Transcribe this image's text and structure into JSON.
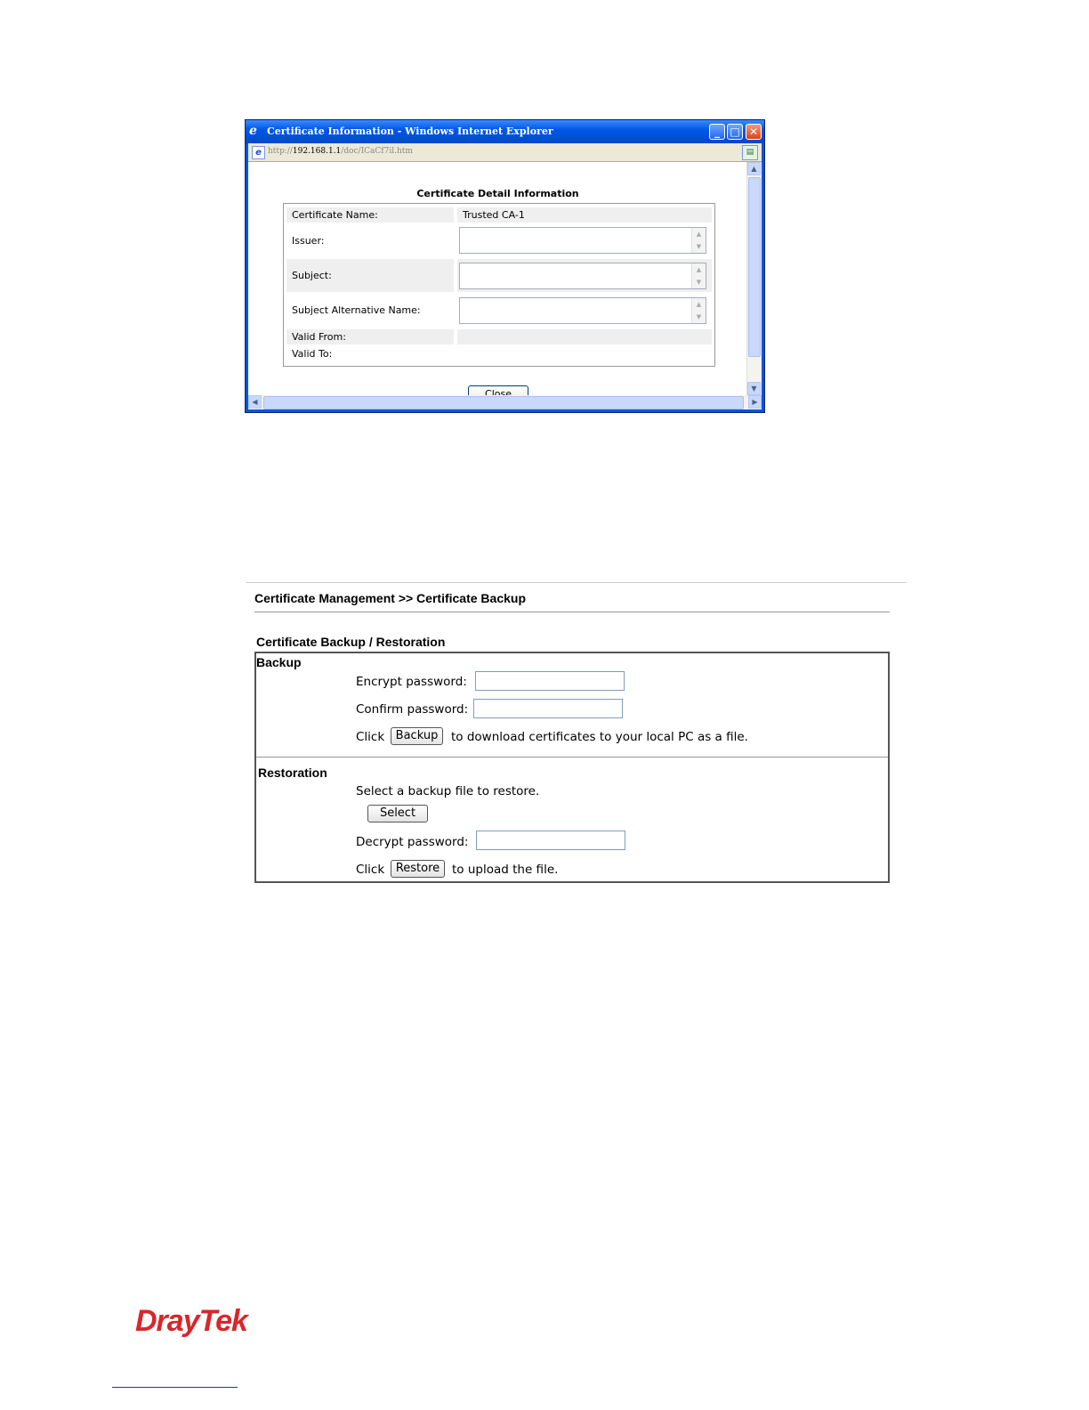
{
  "popup": {
    "window_title": "Certificate Information - Windows Internet Explorer",
    "address": {
      "prefix": "http://",
      "host": "192.168.1.1",
      "path": "/doc/ICaCf7il.htm"
    },
    "heading": "Certificate Detail Information",
    "rows": {
      "cert_name_label": "Certificate Name:",
      "cert_name_value": "Trusted CA-1",
      "issuer_label": "Issuer:",
      "subject_label": "Subject:",
      "subject_alt_label": "Subject Alternative Name:",
      "valid_from_label": "Valid From:",
      "valid_to_label": "Valid To:"
    },
    "close_label": "Close"
  },
  "backup_page": {
    "breadcrumb": "Certificate Management >> Certificate Backup",
    "section_title": "Certificate Backup / Restoration",
    "backup": {
      "label": "Backup",
      "encrypt_label": "Encrypt password:",
      "confirm_label": "Confirm password:",
      "click_label": "Click",
      "button": "Backup",
      "after_text": "to download certificates to your local PC as a file."
    },
    "restoration": {
      "label": "Restoration",
      "select_text": "Select a backup file to restore.",
      "select_button": "Select",
      "decrypt_label": "Decrypt password:",
      "click_label": "Click",
      "button": "Restore",
      "after_text": "to upload the file."
    }
  },
  "footer": {
    "logo": "DrayTek"
  },
  "colors": {
    "logo_red": "#d8262b",
    "titlebar_blue": "#0058e6"
  }
}
